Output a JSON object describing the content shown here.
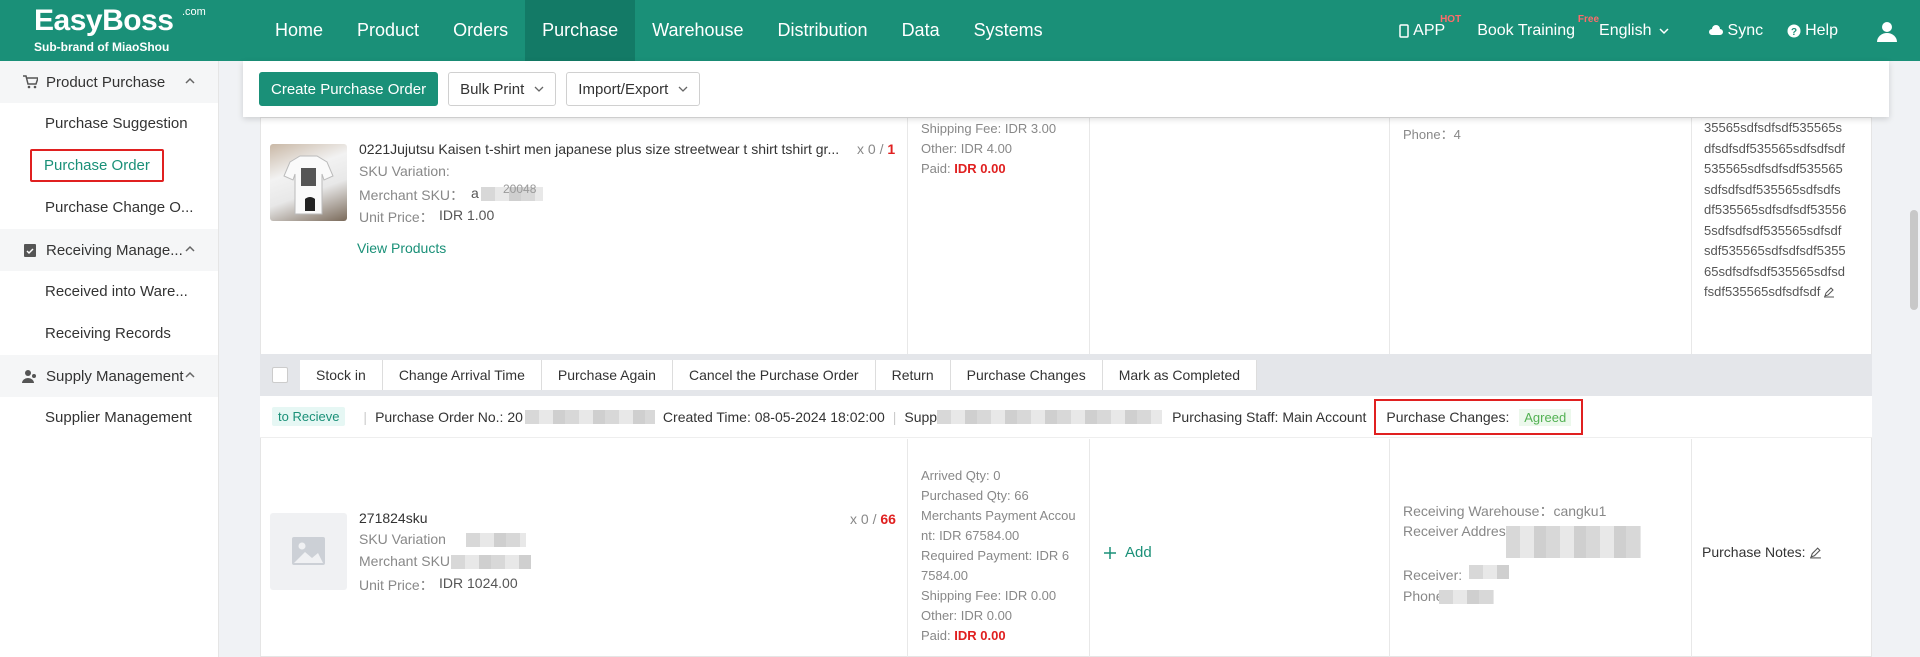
{
  "brand": {
    "name": "EasyBoss",
    "com": ".com",
    "sub": "Sub-brand of MiaoShou"
  },
  "nav": {
    "items": [
      "Home",
      "Product",
      "Orders",
      "Purchase",
      "Warehouse",
      "Distribution",
      "Data",
      "Systems"
    ],
    "active": "Purchase"
  },
  "right_nav": {
    "app": "APP",
    "app_badge": "HOT",
    "training": "Book Training",
    "training_badge": "Free",
    "language": "English",
    "sync": "Sync",
    "help": "Help"
  },
  "sidebar": {
    "groups": [
      {
        "label": "Product Purchase",
        "items": [
          "Purchase Suggestion",
          "Purchase Order",
          "Purchase Change O..."
        ]
      },
      {
        "label": "Receiving Manage...",
        "items": [
          "Received into Ware...",
          "Receiving Records"
        ]
      },
      {
        "label": "Supply Management",
        "items": [
          "Supplier Management"
        ]
      }
    ],
    "active_item": "Purchase Order"
  },
  "toolbar": {
    "create": "Create Purchase Order",
    "bulk_print": "Bulk Print",
    "import_export": "Import/Export"
  },
  "order1": {
    "product_name": "0221Jujutsu Kaisen t-shirt men japanese plus size streetwear t shirt tshirt gr...",
    "qty_done": "x 0 /",
    "qty_total": "1",
    "sku_variation": "SKU Variation:",
    "merchant_sku": "Merchant SKU：",
    "merchant_sku_partial": "a",
    "merchant_sku_partial2": "20048",
    "unit_price_label": "Unit Price：",
    "unit_price": "IDR 1.00",
    "view_products": "View Products",
    "shipping_fee": "Shipping Fee: IDR 3.00",
    "other": "Other: IDR 4.00",
    "paid_label": "Paid:",
    "paid": "IDR 0.00",
    "phone": "Phone：4",
    "notes_lines": [
      "35565sdfsdfsdf535565s",
      "dfsdfsdf535565sdfsdfsdf",
      "535565sdfsdfsdf535565",
      "sdfsdfsdf535565sdfsdfs",
      "df535565sdfsdfsdf53556",
      "5sdfsdfsdf535565sdfsdf",
      "sdf535565sdfsdfsdf5355",
      "65sdfsdfsdf535565sdfsd",
      "fsdf535565sdfsdfsdf"
    ]
  },
  "actions": [
    "Stock in",
    "Change Arrival Time",
    "Purchase Again",
    "Cancel the Purchase Order",
    "Return",
    "Purchase Changes",
    "Mark as Completed"
  ],
  "order2": {
    "status": "to Recieve",
    "po_label": "Purchase Order No.: 20",
    "created": "Created Time: 08-05-2024 18:02:00",
    "supplier": "Supp",
    "staff": "Purchasing Staff: Main Account",
    "changes_label": "Purchase Changes:",
    "changes_value": "Agreed",
    "sku": "271824sku",
    "qty_done": "x 0 /",
    "qty_total": "66",
    "sku_variation": "SKU Variation",
    "merchant_sku": "Merchant SKU",
    "unit_price_label": "Unit Price：",
    "unit_price": "IDR 1024.00",
    "arrived": "Arrived Qty: 0",
    "purchased": "Purchased Qty: 66",
    "merchant_payment": "Merchants Payment Accou",
    "merchant_payment2": "nt: IDR 67584.00",
    "required": "Required Payment: IDR 6",
    "required2": "7584.00",
    "shipping": "Shipping Fee: IDR 0.00",
    "other": "Other: IDR 0.00",
    "paid_label": "Paid:",
    "paid": "IDR 0.00",
    "add": "Add",
    "warehouse": "Receiving Warehouse：cangku1",
    "address": "Receiver Addres",
    "receiver": "Receiver:",
    "phone": "Phone",
    "notes": "Purchase Notes:"
  }
}
